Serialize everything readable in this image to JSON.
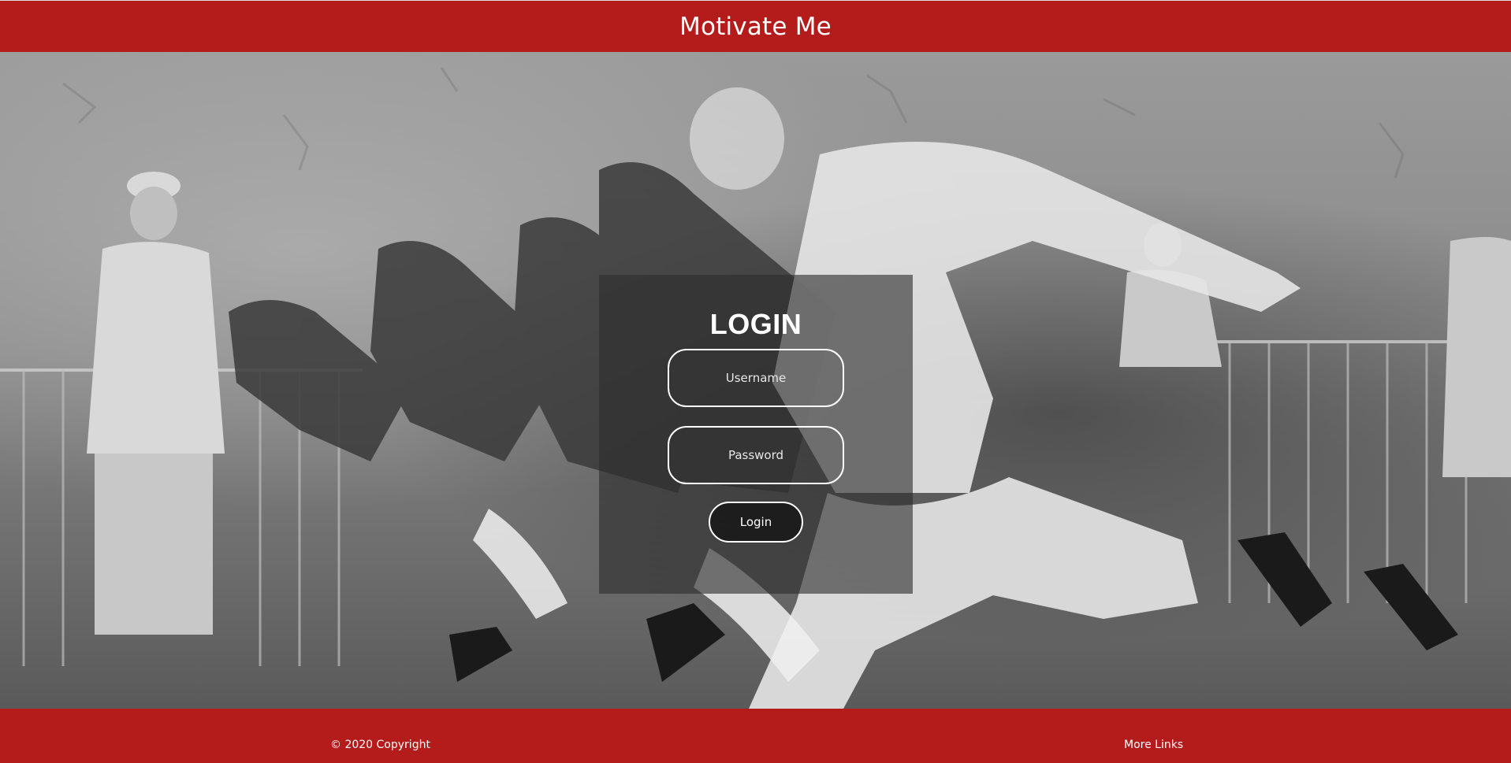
{
  "header": {
    "title": "Motivate Me"
  },
  "hero": {
    "image_description_icon": "runners-photo"
  },
  "login": {
    "title": "LOGIN",
    "username_placeholder": "Username",
    "password_placeholder": "Password",
    "button_label": "Login"
  },
  "footer": {
    "copyright": "© 2020 Copyright",
    "more_links": "More Links"
  },
  "colors": {
    "brand_red": "#b41b1b",
    "panel": "rgba(45,45,45,0.62)",
    "text": "#ffffff"
  }
}
